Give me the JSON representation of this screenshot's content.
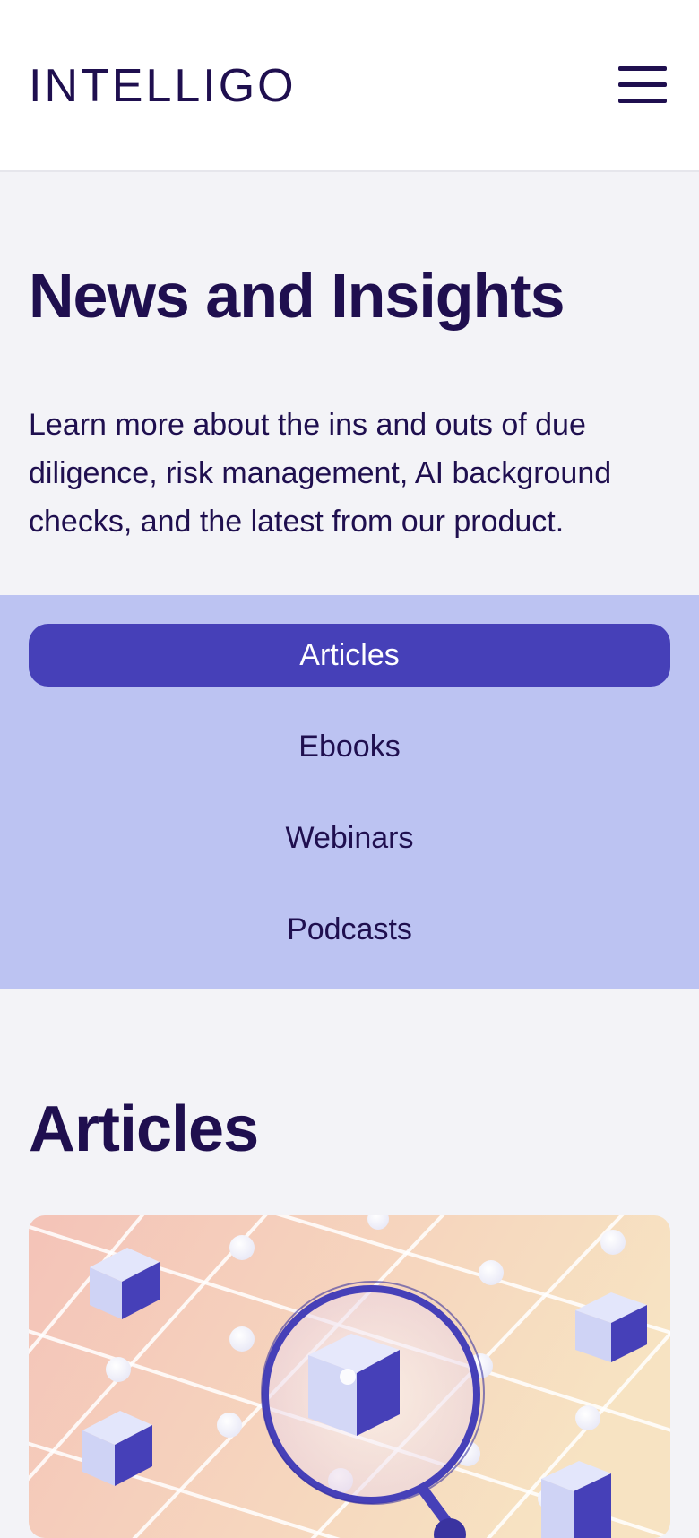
{
  "header": {
    "logo_text": "INTELLIGO",
    "menu_icon": "hamburger-menu-icon"
  },
  "hero": {
    "title": "News and Insights",
    "description": "Learn more about the ins and outs of due diligence, risk management, AI background checks, and the latest from our product."
  },
  "tabs": [
    {
      "label": "Articles",
      "active": true
    },
    {
      "label": "Ebooks",
      "active": false
    },
    {
      "label": "Webinars",
      "active": false
    },
    {
      "label": "Podcasts",
      "active": false
    }
  ],
  "articles": {
    "heading": "Articles",
    "featured_image": "magnifier-over-cube-network-illustration"
  },
  "colors": {
    "brand_dark": "#1f0f4f",
    "accent": "#4640b8",
    "tab_band": "#bcc3f2",
    "page_bg": "#f3f3f7"
  }
}
